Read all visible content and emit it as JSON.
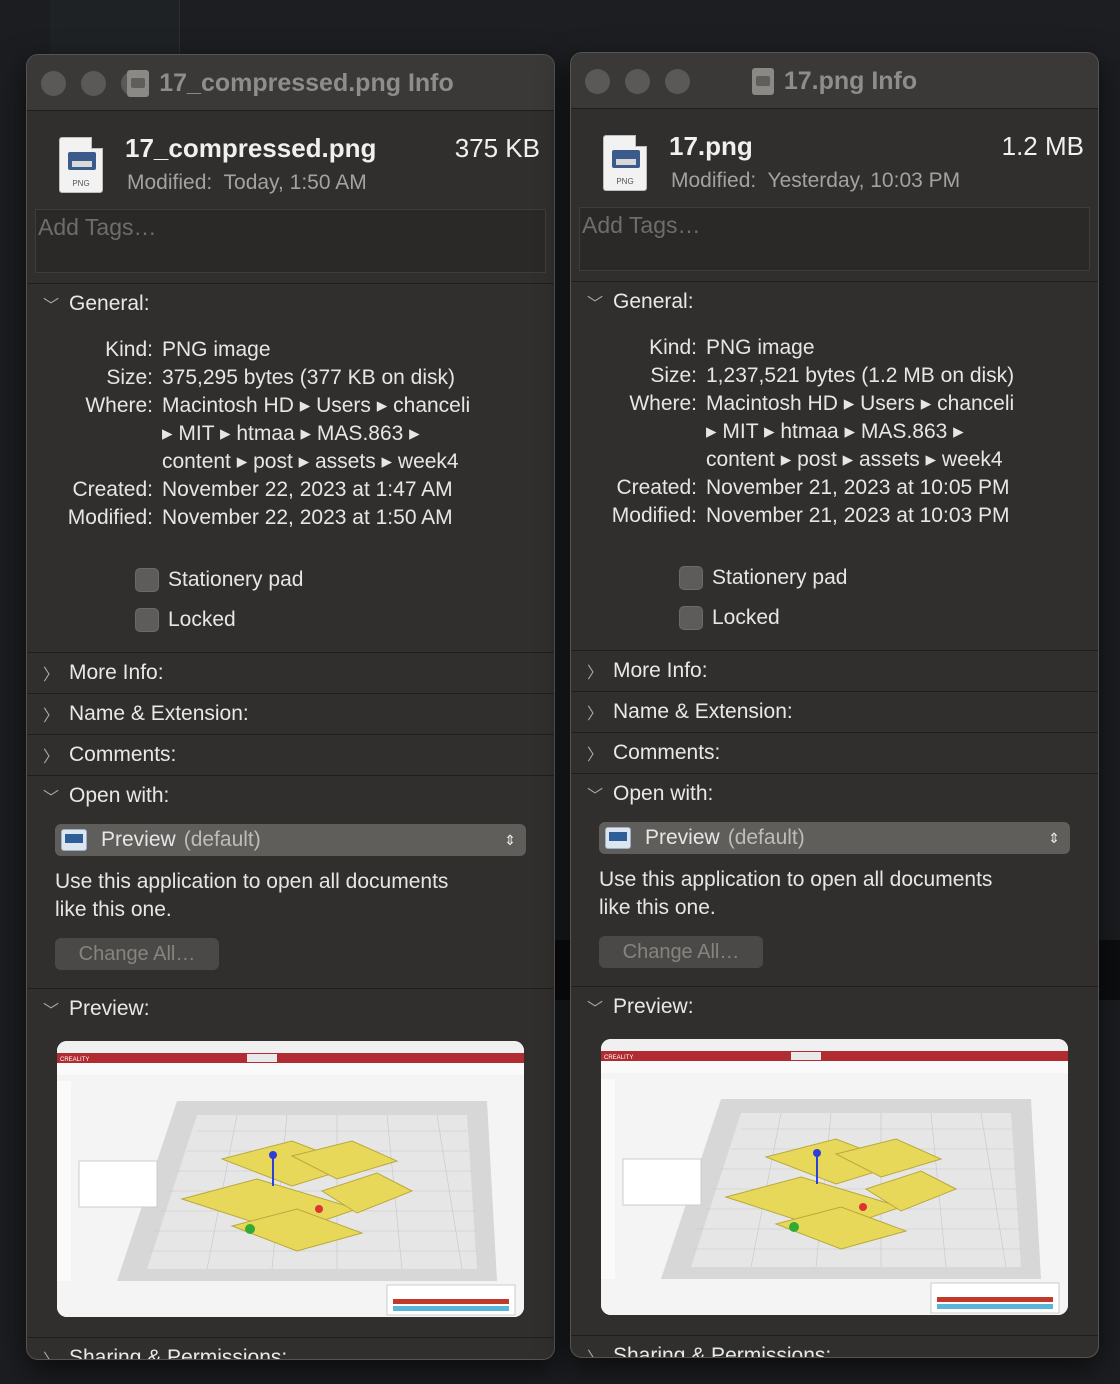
{
  "windows": [
    {
      "title": "17_compressed.png Info",
      "file_name": "17_compressed.png",
      "file_size": "375 KB",
      "modified_label": "Modified:",
      "modified_value": "Today, 1:50 AM",
      "file_icon_label": "PNG",
      "tags_placeholder": "Add Tags…",
      "general": {
        "label": "General:",
        "kind_label": "Kind:",
        "kind": "PNG image",
        "size_label": "Size:",
        "size": "375,295 bytes (377 KB on disk)",
        "where_label": "Where:",
        "where_1": "Macintosh HD ▸ Users ▸ chanceli",
        "where_2": "▸ MIT ▸ htmaa ▸ MAS.863 ▸",
        "where_3": "content ▸ post ▸ assets ▸ week4",
        "created_label": "Created:",
        "created": "November 22, 2023 at 1:47 AM",
        "modified_label": "Modified:",
        "modified": "November 22, 2023 at 1:50 AM",
        "stationery": "Stationery pad",
        "locked": "Locked"
      },
      "more_info": "More Info:",
      "name_ext": "Name & Extension:",
      "comments": "Comments:",
      "open_with": {
        "label": "Open with:",
        "app": "Preview",
        "default": "(default)",
        "desc_1": "Use this application to open all documents",
        "desc_2": "like this one.",
        "change_all": "Change All…"
      },
      "preview_label": "Preview:",
      "sharing": "Sharing & Permissions:"
    },
    {
      "title": "17.png Info",
      "file_name": "17.png",
      "file_size": "1.2 MB",
      "modified_label": "Modified:",
      "modified_value": "Yesterday, 10:03 PM",
      "file_icon_label": "PNG",
      "tags_placeholder": "Add Tags…",
      "general": {
        "label": "General:",
        "kind_label": "Kind:",
        "kind": "PNG image",
        "size_label": "Size:",
        "size": "1,237,521 bytes (1.2 MB on disk)",
        "where_label": "Where:",
        "where_1": "Macintosh HD ▸ Users ▸ chanceli",
        "where_2": "▸ MIT ▸ htmaa ▸ MAS.863 ▸",
        "where_3": "content ▸ post ▸ assets ▸ week4",
        "created_label": "Created:",
        "created": "November 21, 2023 at 10:05 PM",
        "modified_label": "Modified:",
        "modified": "November 21, 2023 at 10:03 PM",
        "stationery": "Stationery pad",
        "locked": "Locked"
      },
      "more_info": "More Info:",
      "name_ext": "Name & Extension:",
      "comments": "Comments:",
      "open_with": {
        "label": "Open with:",
        "app": "Preview",
        "default": "(default)",
        "desc_1": "Use this application to open all documents",
        "desc_2": "like this one.",
        "change_all": "Change All…"
      },
      "preview_label": "Preview:",
      "sharing": "Sharing & Permissions:"
    }
  ],
  "preview_thumbnail": {
    "app_name": "CREALITY",
    "tabs": [
      "PREPARE",
      "PREVIEW",
      "MONITOR"
    ],
    "accent": "#c0392b",
    "model_color": "#e8d85a"
  }
}
